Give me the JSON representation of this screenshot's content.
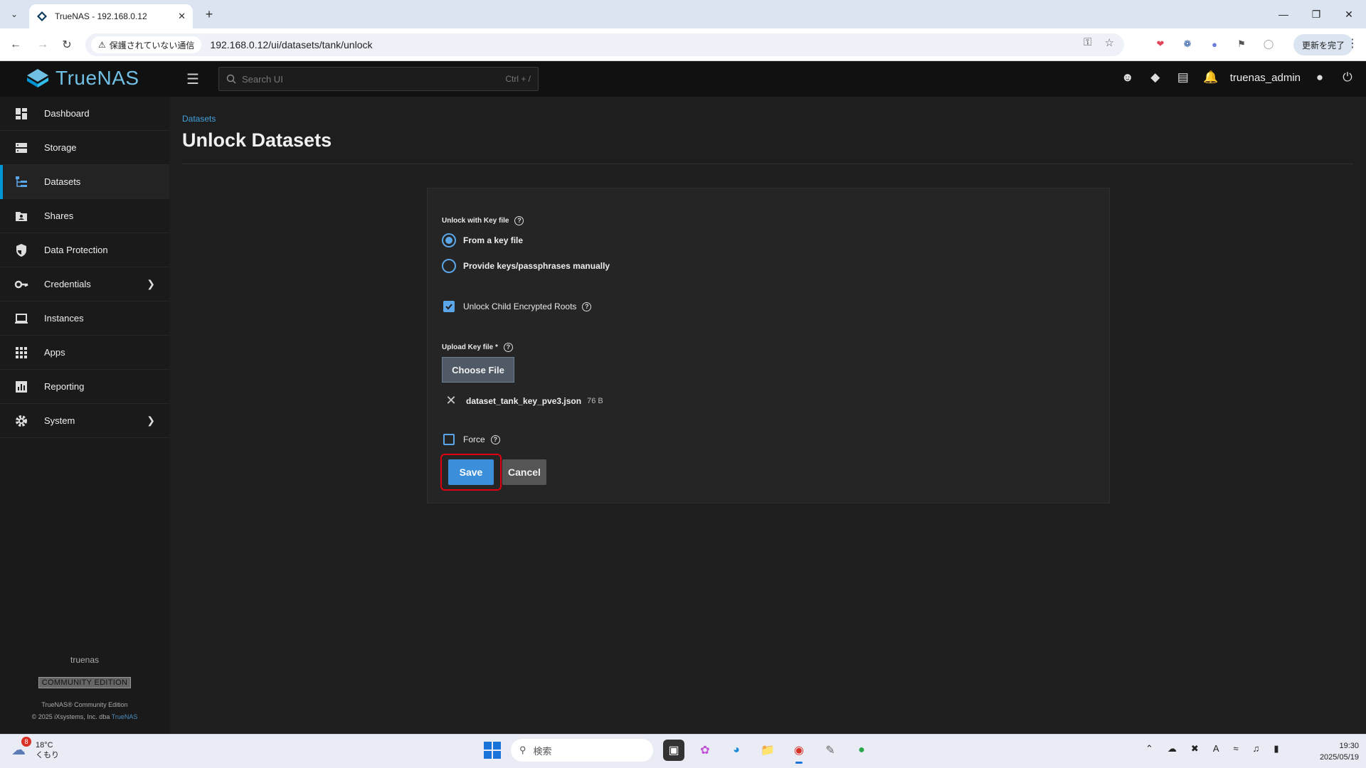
{
  "browser": {
    "tab_title": "TrueNAS - 192.168.0.12",
    "security_label": "保護されていない通信",
    "url": "192.168.0.12/ui/datasets/tank/unlock",
    "update_button": "更新を完了"
  },
  "app": {
    "logo_text": "TrueNAS",
    "search_placeholder": "Search UI",
    "search_shortcut": "Ctrl + /",
    "username": "truenas_admin"
  },
  "sidebar": {
    "items": [
      {
        "label": "Dashboard"
      },
      {
        "label": "Storage"
      },
      {
        "label": "Datasets"
      },
      {
        "label": "Shares"
      },
      {
        "label": "Data Protection"
      },
      {
        "label": "Credentials"
      },
      {
        "label": "Instances"
      },
      {
        "label": "Apps"
      },
      {
        "label": "Reporting"
      },
      {
        "label": "System"
      }
    ],
    "active": "Datasets",
    "hostname": "truenas",
    "edition": "COMMUNITY EDITION",
    "copyright_line1": "TrueNAS® Community Edition",
    "copyright_line2": "© 2025 iXsystems, Inc. dba",
    "copyright_brand": "TrueNAS"
  },
  "page": {
    "breadcrumb": "Datasets",
    "title": "Unlock Datasets"
  },
  "form": {
    "unlock_label": "Unlock with Key file",
    "option_keyfile": "From a key file",
    "option_manual": "Provide keys/passphrases manually",
    "selected_option": "From a key file",
    "unlock_children_label": "Unlock Child Encrypted Roots",
    "unlock_children_checked": true,
    "upload_label": "Upload Key file *",
    "choose_file_button": "Choose File",
    "file_name": "dataset_tank_key_pve3.json",
    "file_size": "76 B",
    "force_label": "Force",
    "force_checked": false,
    "save_button": "Save",
    "cancel_button": "Cancel"
  },
  "taskbar": {
    "weather_temp": "18°C",
    "weather_cond": "くもり",
    "weather_badge": "8",
    "search_placeholder": "検索",
    "time": "19:30",
    "date": "2025/05/19"
  },
  "colors": {
    "accent": "#0095d5",
    "primary_button": "#3b8ed9",
    "highlight_outline": "#e0000f"
  }
}
